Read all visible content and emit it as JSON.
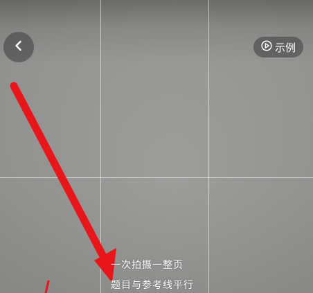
{
  "camera": {
    "back_icon": "chevron-left-icon",
    "example_button": {
      "icon": "play-outline-icon",
      "label": "示例"
    },
    "hint": {
      "line1": "一次拍摄一整页",
      "line2": "题目与参考线平行"
    },
    "colors": {
      "overlay_button_bg": "#3c3c3c",
      "grid_line": "#ffffff",
      "annotation_arrow": "#e8161b",
      "text": "#ffffff"
    }
  }
}
